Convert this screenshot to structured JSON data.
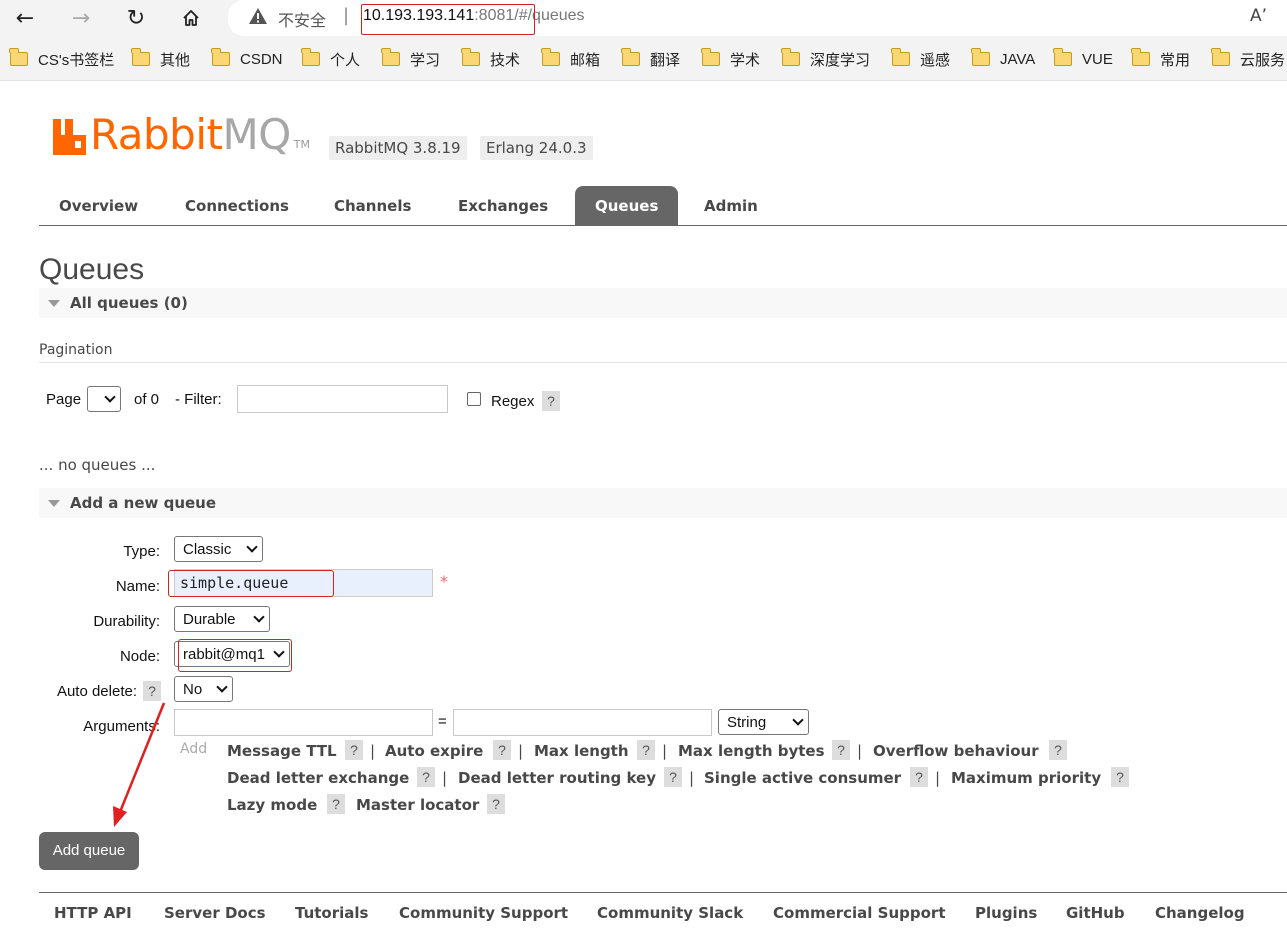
{
  "browser": {
    "insecure_label": "不安全",
    "separator": "|",
    "url_host": "10.193.193.141",
    "url_rest": ":8081/#/queues",
    "read_aloud": "A’",
    "bookmarks": [
      "CS's书签栏",
      "其他",
      "CSDN",
      "个人",
      "学习",
      "技术",
      "邮箱",
      "翻译",
      "学术",
      "深度学习",
      "遥感",
      "JAVA",
      "VUE",
      "常用",
      "云服务"
    ]
  },
  "app": {
    "logo_rabbit": "Rabbit",
    "logo_mq": "MQ",
    "logo_tm": "TM",
    "version_rabbitmq": "RabbitMQ 3.8.19",
    "version_erlang": "Erlang 24.0.3",
    "tabs": [
      "Overview",
      "Connections",
      "Channels",
      "Exchanges",
      "Queues",
      "Admin"
    ],
    "active_tab": "Queues"
  },
  "page": {
    "title": "Queues",
    "all_queues": "All queues (0)",
    "pagination_label": "Pagination",
    "page_label": "Page",
    "of_label": "of 0",
    "filter_label": "- Filter:",
    "regex_label": "Regex",
    "help": "?",
    "no_queues": "... no queues ..."
  },
  "add_queue": {
    "section_title": "Add a new queue",
    "type_label": "Type:",
    "type_value": "Classic",
    "name_label": "Name:",
    "name_value": "simple.queue",
    "required_mark": "*",
    "durability_label": "Durability:",
    "durability_value": "Durable",
    "node_label": "Node:",
    "node_value": "rabbit@mq1",
    "auto_delete_label": "Auto delete:",
    "auto_delete_value": "No",
    "arguments_label": "Arguments:",
    "equals": "=",
    "arg_type_value": "String",
    "add_label": "Add",
    "arg_links_row1": [
      "Message TTL",
      "Auto expire",
      "Max length",
      "Max length bytes",
      "Overflow behaviour"
    ],
    "arg_links_row2": [
      "Dead letter exchange",
      "Dead letter routing key",
      "Single active consumer",
      "Maximum priority"
    ],
    "arg_links_row3": [
      "Lazy mode",
      "Master locator"
    ],
    "pipe": "|",
    "submit_label": "Add queue"
  },
  "footer": {
    "links": [
      "HTTP API",
      "Server Docs",
      "Tutorials",
      "Community Support",
      "Community Slack",
      "Commercial Support",
      "Plugins",
      "GitHub",
      "Changelog"
    ]
  },
  "colors": {
    "brand_orange": "#ff6600",
    "annotation_red": "#d42323",
    "tab_active": "#666666"
  }
}
